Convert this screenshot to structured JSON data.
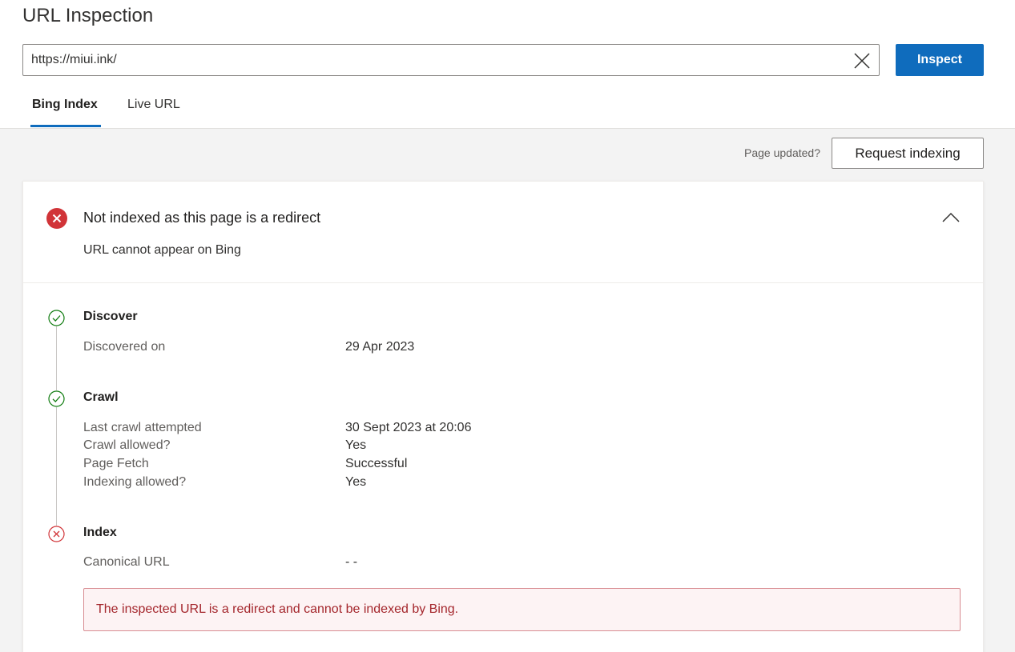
{
  "header": {
    "title": "URL Inspection",
    "url_value": "https://miui.ink/",
    "inspect_label": "Inspect"
  },
  "tabs": [
    {
      "label": "Bing Index",
      "active": true
    },
    {
      "label": "Live URL",
      "active": false
    }
  ],
  "toolbar": {
    "page_updated_text": "Page updated?",
    "request_indexing_label": "Request indexing"
  },
  "status": {
    "title": "Not indexed as this page is a redirect",
    "subtitle": "URL cannot appear on Bing",
    "icon": "error-circle-icon",
    "color": "#d13438"
  },
  "steps": [
    {
      "title": "Discover",
      "state": "success",
      "rows": [
        {
          "label": "Discovered on",
          "value": "29 Apr 2023"
        }
      ]
    },
    {
      "title": "Crawl",
      "state": "success",
      "rows": [
        {
          "label": "Last crawl attempted",
          "value": "30 Sept 2023 at 20:06"
        },
        {
          "label": "Crawl allowed?",
          "value": "Yes"
        },
        {
          "label": "Page Fetch",
          "value": "Successful"
        },
        {
          "label": "Indexing allowed?",
          "value": "Yes"
        }
      ]
    },
    {
      "title": "Index",
      "state": "error",
      "rows": [
        {
          "label": "Canonical URL",
          "value": "- -"
        }
      ]
    }
  ],
  "error_message": "The inspected URL is a redirect and cannot be indexed by Bing.",
  "colors": {
    "accent": "#0f6cbd",
    "success": "#107c10",
    "error": "#d13438"
  }
}
